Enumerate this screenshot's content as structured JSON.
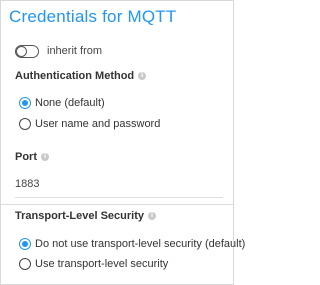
{
  "title": "Credentials for MQTT",
  "inherit": {
    "label": "inherit from",
    "enabled": false
  },
  "authentication": {
    "label": "Authentication Method",
    "info_icon": "info-icon",
    "options": [
      {
        "label": "None (default)",
        "selected": true
      },
      {
        "label": "User name and password",
        "selected": false
      }
    ]
  },
  "port": {
    "label": "Port",
    "info_icon": "info-icon",
    "value": "1883"
  },
  "tls": {
    "label": "Transport-Level Security",
    "info_icon": "info-icon",
    "options": [
      {
        "label": "Do not use transport-level security (default)",
        "selected": true
      },
      {
        "label": "Use transport-level security",
        "selected": false
      }
    ]
  },
  "colors": {
    "accent": "#2196f3",
    "text": "#333333",
    "border": "#d9d9d9"
  }
}
